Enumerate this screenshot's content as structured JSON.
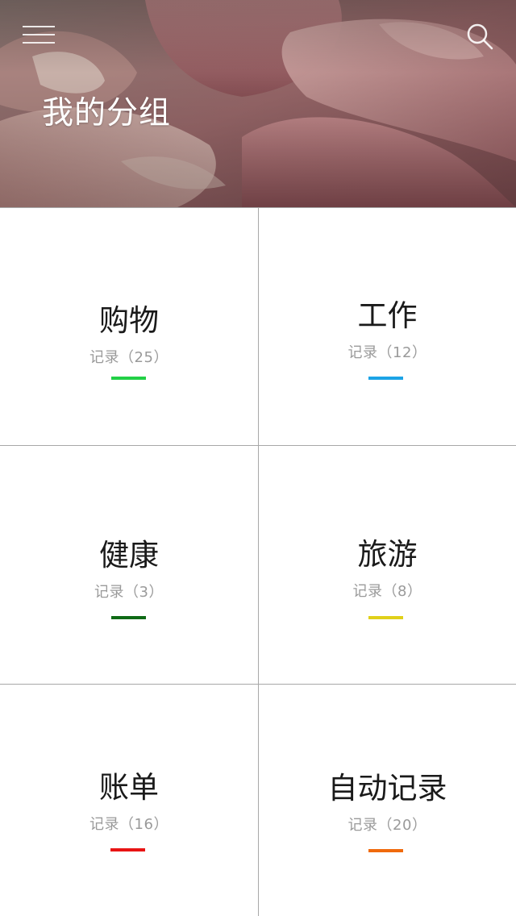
{
  "header": {
    "title": "我的分组",
    "menu_icon": "hamburger-menu-icon",
    "search_icon": "search-icon"
  },
  "groups": [
    {
      "name": "购物",
      "count_label": "记录（25）",
      "count": 25,
      "color": "#22d046"
    },
    {
      "name": "工作",
      "count_label": "记录（12）",
      "count": 12,
      "color": "#1ca3e6"
    },
    {
      "name": "健康",
      "count_label": "记录（3）",
      "count": 3,
      "color": "#0f6a16"
    },
    {
      "name": "旅游",
      "count_label": "记录（8）",
      "count": 8,
      "color": "#e0d01a"
    },
    {
      "name": "账单",
      "count_label": "记录（16）",
      "count": 16,
      "color": "#e81414"
    },
    {
      "name": "自动记录",
      "count_label": "记录（20）",
      "count": 20,
      "color": "#f06a0c"
    }
  ]
}
